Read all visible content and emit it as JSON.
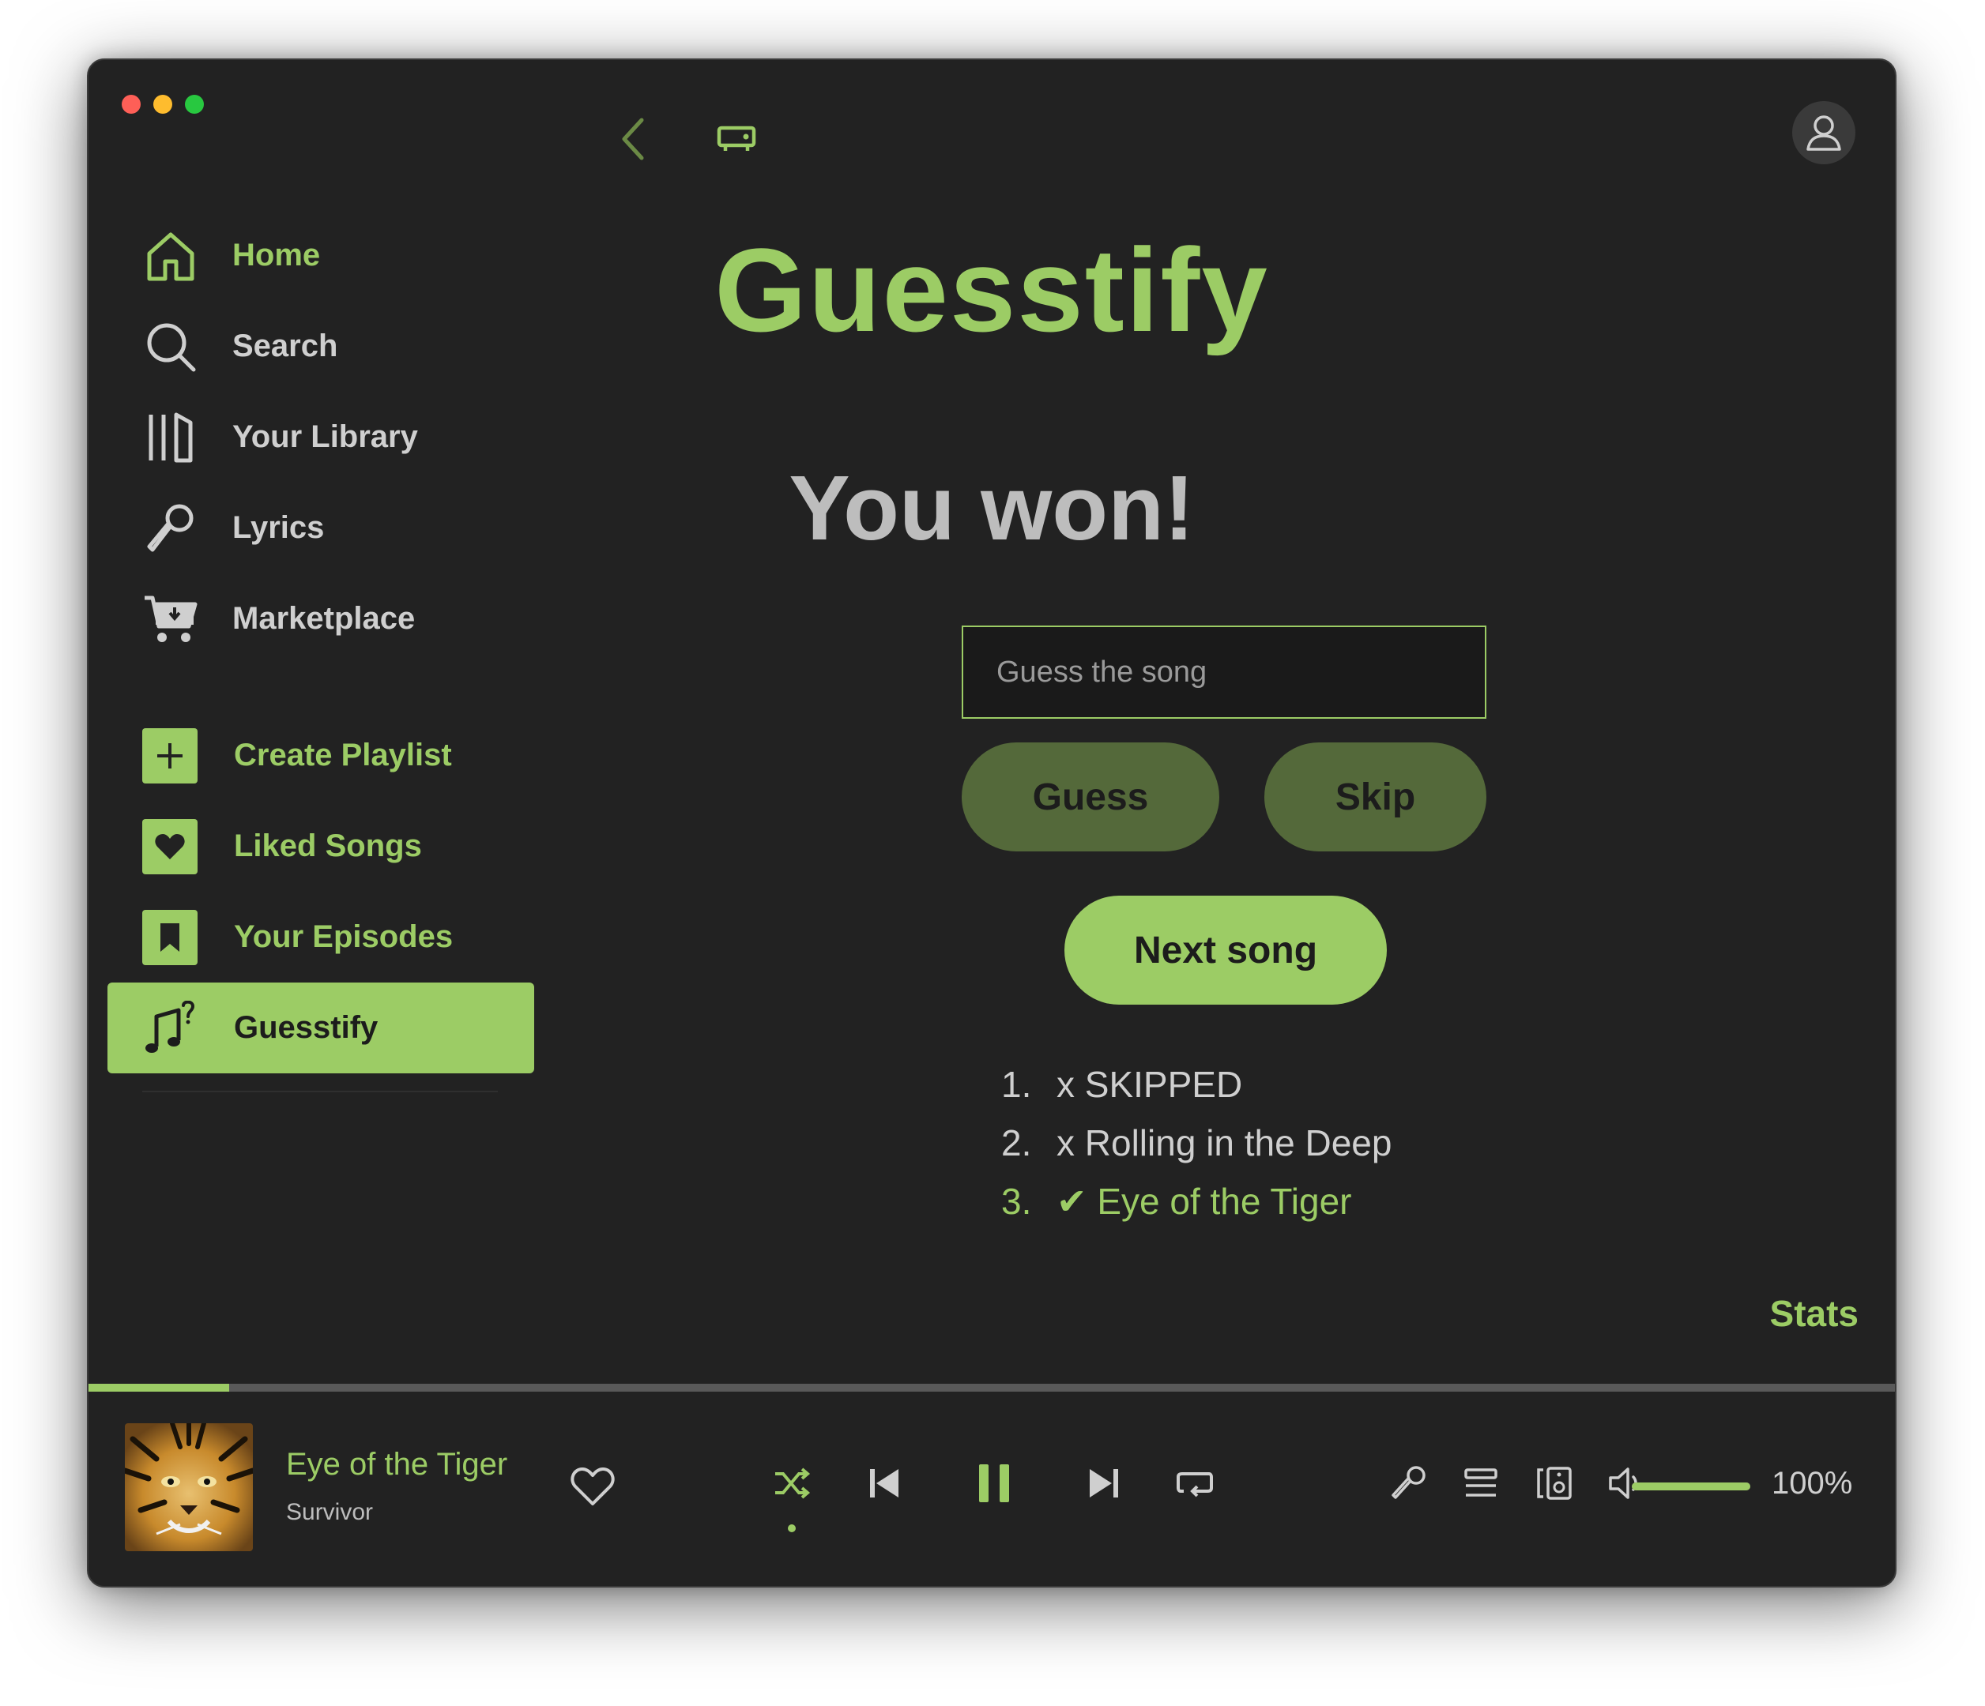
{
  "sidebar": {
    "nav": [
      {
        "label": "Home",
        "icon": "home-icon"
      },
      {
        "label": "Search",
        "icon": "search-icon"
      },
      {
        "label": "Your Library",
        "icon": "library-icon"
      },
      {
        "label": "Lyrics",
        "icon": "microphone-icon"
      },
      {
        "label": "Marketplace",
        "icon": "cart-icon"
      }
    ],
    "lists": [
      {
        "label": "Create Playlist",
        "icon": "plus-icon"
      },
      {
        "label": "Liked Songs",
        "icon": "heart-icon"
      },
      {
        "label": "Your Episodes",
        "icon": "bookmark-icon"
      },
      {
        "label": "Guesstify",
        "icon": "music-note-question-icon",
        "active": true
      }
    ]
  },
  "main": {
    "title": "Guesstify",
    "status": "You won!",
    "input_placeholder": "Guess the song",
    "guess_label": "Guess",
    "skip_label": "Skip",
    "next_label": "Next song",
    "results": [
      {
        "num": "1.",
        "text": "x SKIPPED",
        "correct": false
      },
      {
        "num": "2.",
        "text": "x Rolling in the Deep",
        "correct": false
      },
      {
        "num": "3.",
        "text": "✔ Eye of the Tiger",
        "correct": true
      }
    ],
    "stats_label": "Stats"
  },
  "player": {
    "track_title": "Eye of the Tiger",
    "artist": "Survivor",
    "progress": 0.078,
    "volume_level": 1.0,
    "volume_text": "100%"
  },
  "colors": {
    "accent": "#9ccc65",
    "accent_dark": "#54693a",
    "background": "#222222"
  }
}
